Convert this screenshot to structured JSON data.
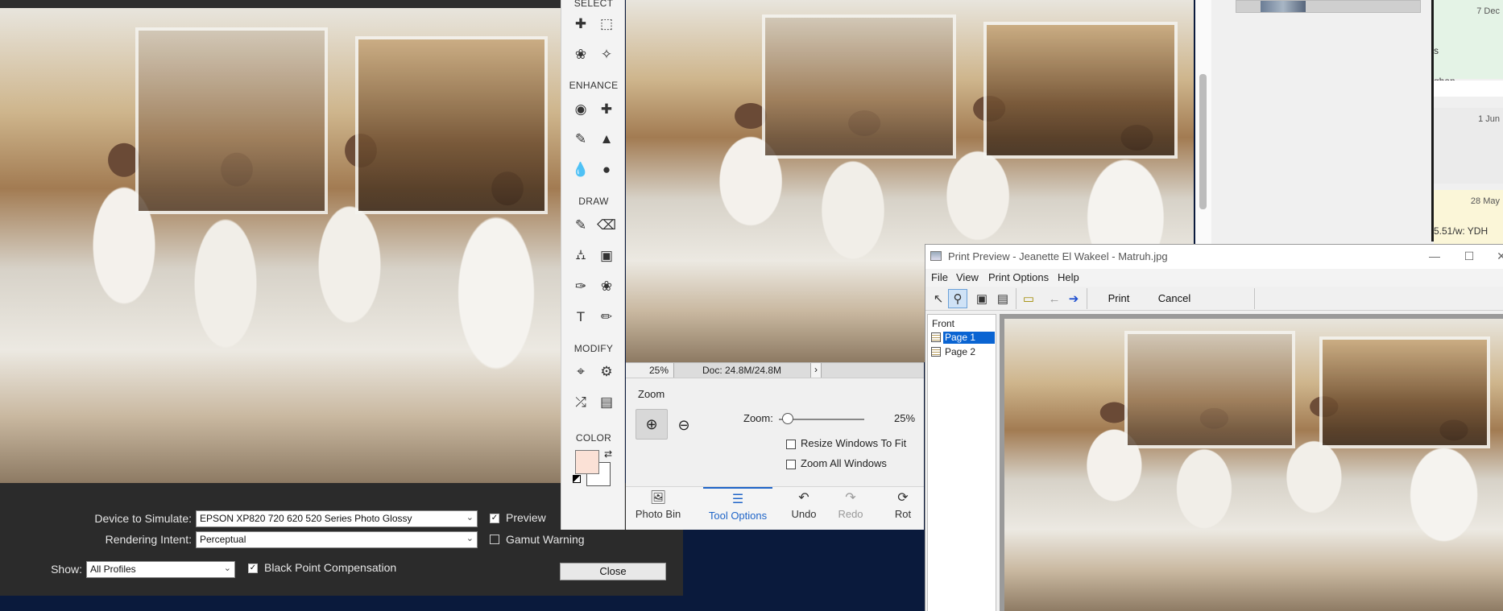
{
  "toolbox": {
    "sections": {
      "select": "SELECT",
      "enhance": "ENHANCE",
      "draw": "DRAW",
      "modify": "MODIFY",
      "color": "COLOR"
    }
  },
  "status": {
    "zoom": "25%",
    "doc": "Doc: 24.8M/24.8M"
  },
  "tool_options": {
    "title": "Zoom",
    "zoom_label": "Zoom:",
    "zoom_value": "25%",
    "zoom_level_percent": 25,
    "resize_windows": "Resize Windows To Fit",
    "zoom_all_windows": "Zoom All Windows"
  },
  "actions": {
    "photo_bin": "Photo Bin",
    "tool_options": "Tool Options",
    "undo": "Undo",
    "redo": "Redo",
    "rotate": "Rot"
  },
  "proof": {
    "device_label": "Device to Simulate:",
    "device_value": "EPSON XP820 720 620 520 Series Photo Glossy",
    "intent_label": "Rendering Intent:",
    "intent_value": "Perceptual",
    "show_label": "Show:",
    "show_value": "All Profiles",
    "preview": "Preview",
    "gamut_warning": "Gamut Warning",
    "black_point": "Black Point Compensation",
    "close": "Close"
  },
  "right_pane": {
    "cells": [
      {
        "date": "7 Dec",
        "text": ""
      },
      {
        "date": "",
        "text": "s"
      },
      {
        "date": "",
        "text": "ghan"
      },
      {
        "date": "1 Jun",
        "text": ""
      },
      {
        "date": "28 May",
        "text": ""
      },
      {
        "date": "",
        "text": "5.51/w: YDH"
      }
    ]
  },
  "print_preview": {
    "title": "Print Preview - Jeanette El Wakeel - Matruh.jpg",
    "menu": {
      "file": "File",
      "view": "View",
      "print_options": "Print Options",
      "help": "Help"
    },
    "print": "Print",
    "cancel": "Cancel",
    "tree": {
      "root": "Front",
      "pages": [
        "Page 1",
        "Page 2"
      ]
    }
  },
  "colors": {
    "accent": "#1e64c8",
    "foreground": "#fbe1d6",
    "background": "#ffffff",
    "selection": "#0a64d2"
  }
}
